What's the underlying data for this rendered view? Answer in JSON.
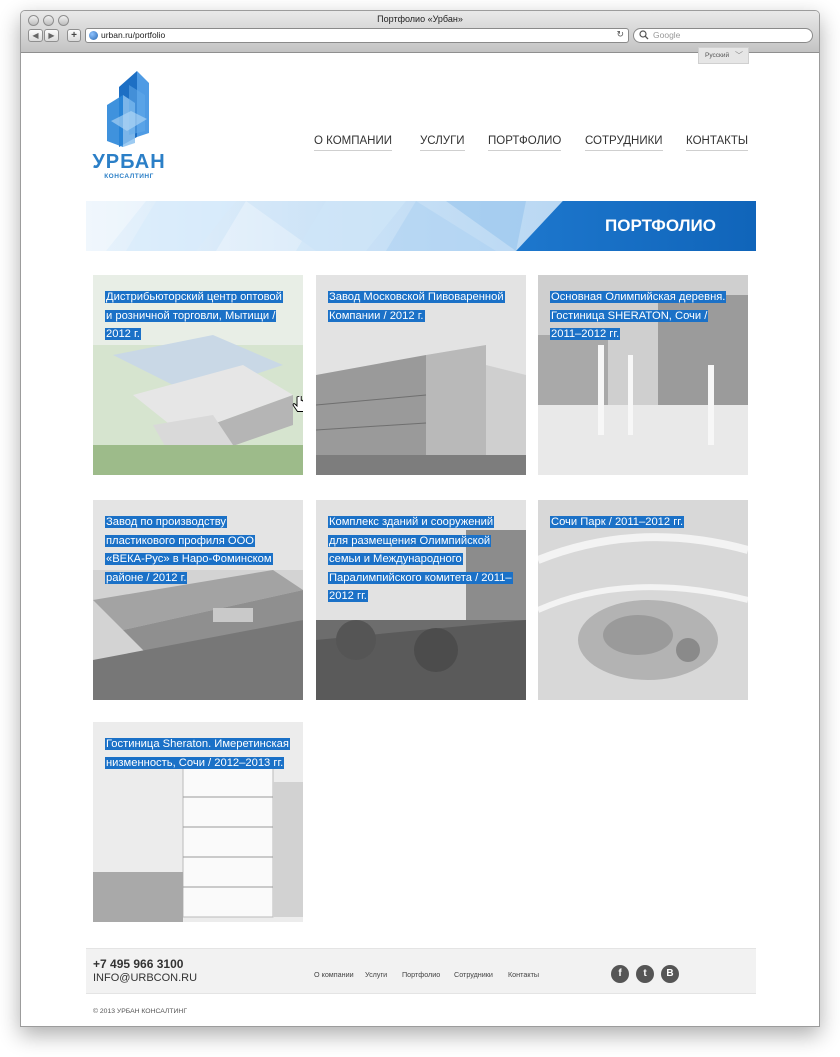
{
  "browser": {
    "window_title": "Портфолио «Урбан»",
    "url": "urban.ru/portfolio",
    "search_placeholder": "Google",
    "back": "◀",
    "forward": "▶",
    "add": "+"
  },
  "language": {
    "selected": "Русский"
  },
  "logo": {
    "title": "УРБАН",
    "subtitle": "КОНСАЛТИНГ"
  },
  "nav": [
    "О КОМПАНИИ",
    "УСЛУГИ",
    "ПОРТФОЛИО",
    "СОТРУДНИКИ",
    "КОНТАКТЫ"
  ],
  "banner": {
    "title": "ПОРТФОЛИО"
  },
  "projects": [
    "Дистрибьюторский центр оптовой и розничной торговли, Мытищи / 2012 г.",
    "Завод Московской Пивоваренной Компании / 2012 г.",
    "Основная Олимпийская деревня. Гостиница SHERATON, Сочи / 2011–2012 гг.",
    "Завод по производству пластикового профиля ООО «ВЕКА-Рус» в Наро-Фоминском районе / 2012 г.",
    "Комплекс зданий и сооружений для размещения Олимпийской семьи и Международного Паралимпийского комитета / 2011–2012 гг.",
    "Сочи Парк / 2011–2012 гг.",
    "Гостиница Sheraton. Имеретинская низменность, Сочи / 2012–2013 гг."
  ],
  "footer": {
    "phone": "+7 495 966 3100",
    "email": "INFO@URBCON.RU",
    "links": [
      "О компании",
      "Услуги",
      "Портфолио",
      "Сотрудники",
      "Контакты"
    ],
    "social": [
      "f",
      "t",
      "В"
    ],
    "copyright": "© 2013 УРБАН КОНСАЛТИНГ"
  },
  "colors": {
    "accent": "#1b71c7",
    "text": "#333333"
  },
  "icons": [
    "globe-icon",
    "reload-icon",
    "search-icon",
    "chevron-down-icon",
    "hand-cursor-icon",
    "facebook-icon",
    "twitter-icon",
    "vk-icon"
  ]
}
